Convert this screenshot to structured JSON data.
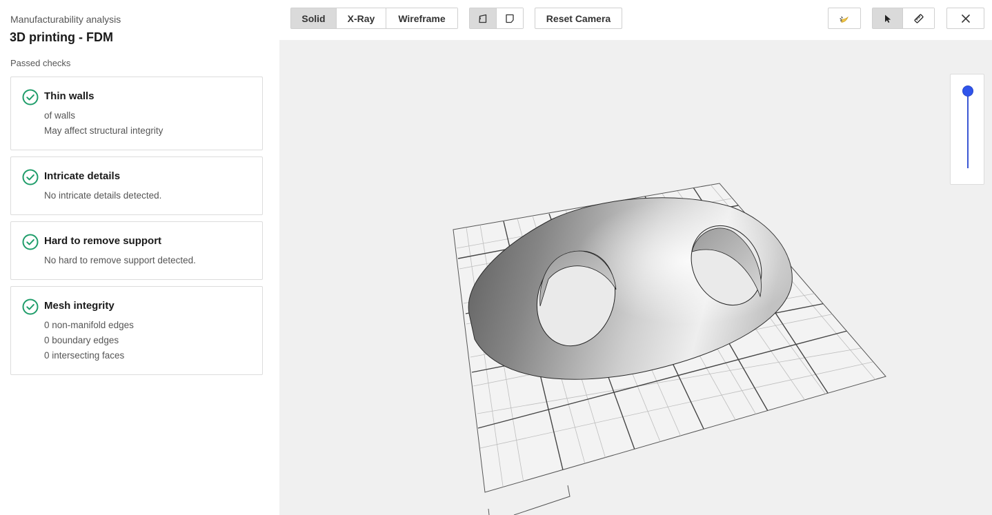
{
  "panel": {
    "eyebrow": "Manufacturability analysis",
    "title": "3D printing - FDM",
    "section_label": "Passed checks",
    "checks": [
      {
        "title": "Thin walls",
        "lines": [
          "of walls",
          "May affect structural integrity"
        ]
      },
      {
        "title": "Intricate details",
        "lines": [
          "No intricate details detected."
        ]
      },
      {
        "title": "Hard to remove support",
        "lines": [
          "No hard to remove support detected."
        ]
      },
      {
        "title": "Mesh integrity",
        "lines": [
          "0 non-manifold edges",
          "0 boundary edges",
          "0 intersecting faces"
        ]
      }
    ]
  },
  "toolbar": {
    "view_modes": [
      "Solid",
      "X-Ray",
      "Wireframe"
    ],
    "active_view_mode": "Solid",
    "projection_icons": [
      "perspective-icon",
      "orthographic-icon"
    ],
    "active_projection": "perspective-icon",
    "reset_camera_label": "Reset Camera",
    "lighting_icon": "light-icon",
    "tool_icons": [
      "cursor-icon",
      "ruler-icon"
    ],
    "active_tool": "cursor-icon",
    "close_icon": "close-icon"
  },
  "slider": {
    "value": 1.0
  },
  "colors": {
    "accent": "#2f54eb",
    "check_green": "#1f9d6a",
    "viewport_bg": "#f0f0f0"
  }
}
